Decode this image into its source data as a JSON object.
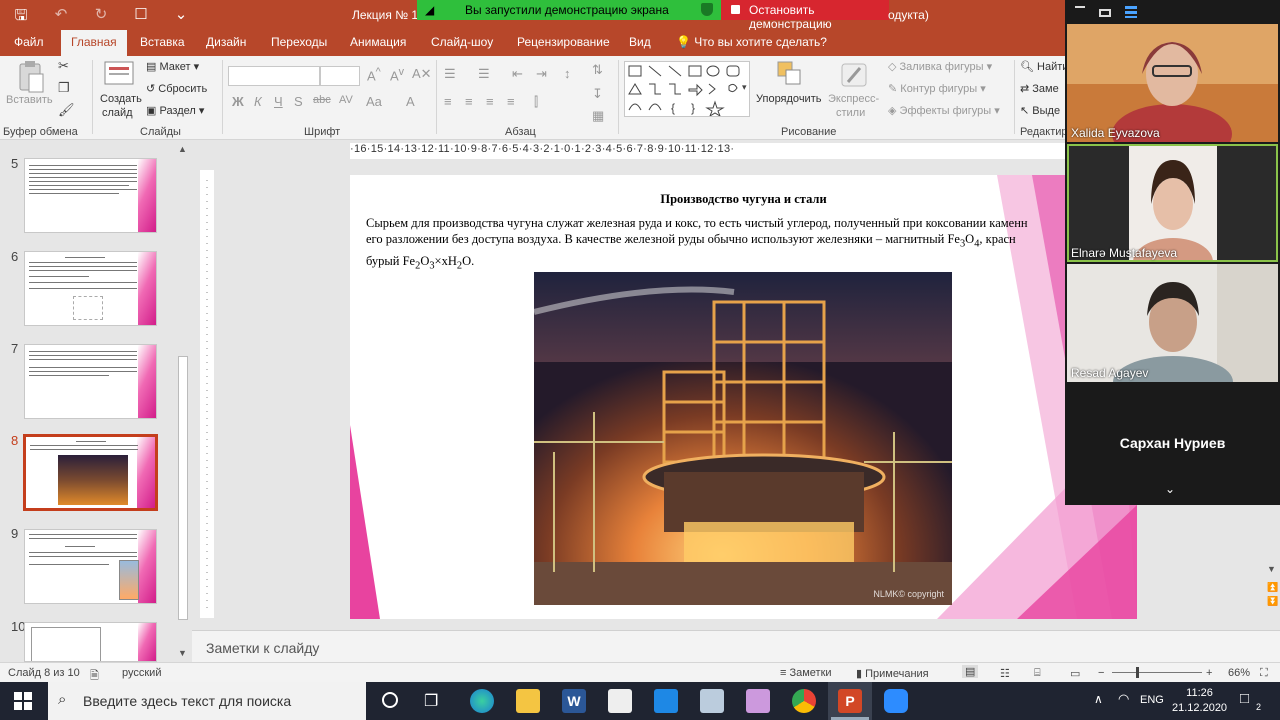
{
  "window": {
    "doc_title": "Лекция № 11",
    "title_suffix": "одукта)",
    "share_banner_text": "Вы запустили демонстрацию экрана",
    "stop_share_label": "Остановить демонстрацию"
  },
  "tabs": [
    "Файл",
    "Главная",
    "Вставка",
    "Дизайн",
    "Переходы",
    "Анимация",
    "Слайд-шоу",
    "Рецензирование",
    "Вид"
  ],
  "tell_me": "Что вы хотите сделать?",
  "ribbon": {
    "paste": "Вставить",
    "create_slide_1": "Создать",
    "create_slide_2": "слайд",
    "layout": "Макет",
    "reset": "Сбросить",
    "section": "Раздел",
    "arrange": "Упорядочить",
    "quick_styles_1": "Экспресс-",
    "quick_styles_2": "стили",
    "shape_fill": "Заливка фигуры",
    "shape_outline": "Контур фигуры",
    "shape_effects": "Эффекты фигуры",
    "find": "Найти",
    "replace": "Заме",
    "select": "Выде",
    "groups": {
      "clipboard": "Буфер обмена",
      "slides": "Слайды",
      "font": "Шрифт",
      "paragraph": "Абзац",
      "drawing": "Рисование",
      "editing": "Редактир"
    }
  },
  "thumbnails": [
    {
      "num": "5"
    },
    {
      "num": "6"
    },
    {
      "num": "7"
    },
    {
      "num": "8"
    },
    {
      "num": "9"
    },
    {
      "num": "10"
    }
  ],
  "ruler_text": "·16·15·14·13·12·11·10·9·8·7·6·5·4·3·2·1·0·1·2·3·4·5·6·7·8·9·10·11·12·13·",
  "slide": {
    "title": "Производство чугуна и стали",
    "line1": "Сырьем для производства чугуна служат железная руда и кокс, то есть чистый углерод, полученный при коксовании каменн",
    "line2_a": "его разложении без доступа воздуха. В качестве железной руды обычно используют железняки – магнитный Fe",
    "line2_sub1": "3",
    "line2_mid": "O",
    "line2_sub2": "4",
    "line2_b": ", красн",
    "line3_a": "бурый Fe",
    "line3_sub1": "2",
    "line3_mid": "O",
    "line3_sub2": "3",
    "line3_b": "×xH",
    "line3_sub3": "2",
    "line3_c": "O.",
    "photo_caption": "NLMK© copyright"
  },
  "notes_placeholder": "Заметки к слайду",
  "status": {
    "slide_counter": "Слайд 8 из 10",
    "language": "русский",
    "notes": "Заметки",
    "comments": "Примечания",
    "zoom": "66%"
  },
  "taskbar": {
    "search_placeholder": "Введите здесь текст для поиска",
    "lang": "ENG",
    "time": "11:26",
    "date": "21.12.2020",
    "notifications": "2"
  },
  "zoom": {
    "participants": [
      "Xalida Eyvazova",
      "Elnarə Mustafayeva",
      "Resad Agayev"
    ],
    "no_video_name": "Сархан Нуриев"
  },
  "colors": {
    "ppt_accent": "#b7472a",
    "zoom_green": "#2fbf3c",
    "zoom_red": "#d7262f",
    "slide_pink": "#e8439f"
  }
}
